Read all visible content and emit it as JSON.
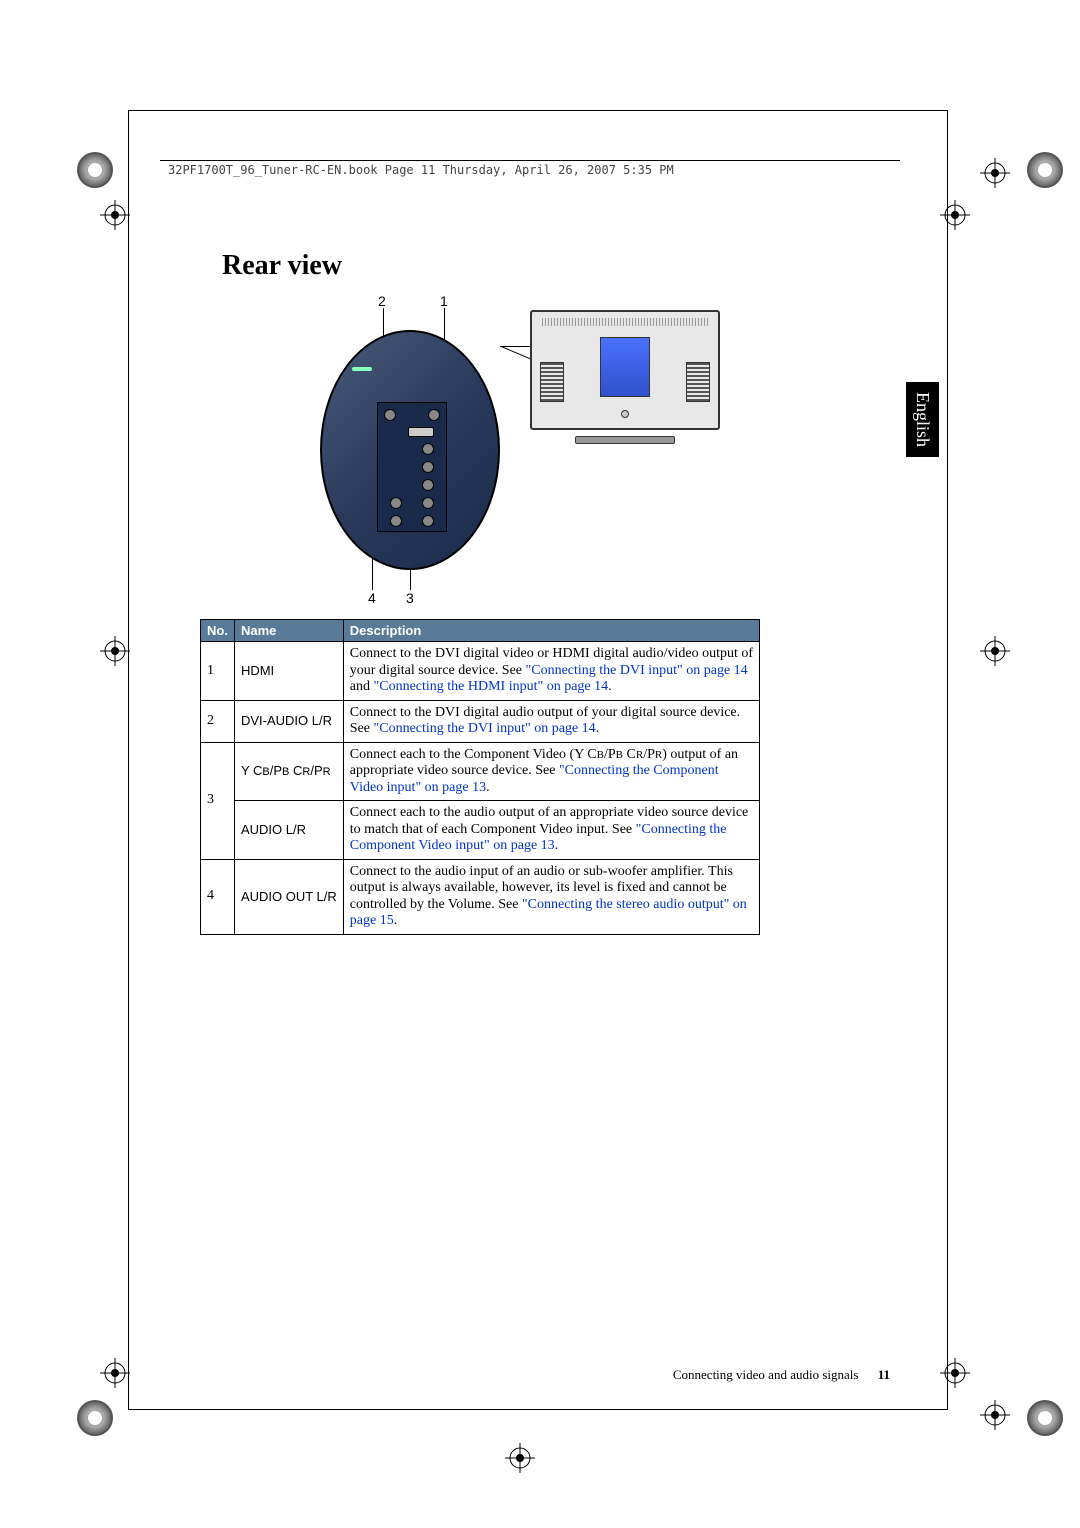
{
  "header_text": "32PF1700T_96_Tuner-RC-EN.book  Page 11  Thursday, April 26, 2007  5:35 PM",
  "title": "Rear view",
  "language_tab": "English",
  "callouts": {
    "c1": "1",
    "c2": "2",
    "c3": "3",
    "c4": "4"
  },
  "table": {
    "headers": {
      "no": "No.",
      "name": "Name",
      "desc": "Description"
    },
    "rows": [
      {
        "no": "1",
        "name": "HDMI",
        "desc_pre": "Connect to the DVI digital video or HDMI digital audio/video output of your digital source device. See ",
        "link1": "\"Connecting the DVI input\" on page 14",
        "mid": " and ",
        "link2": "\"Connecting the HDMI input\" on page 14",
        "post": "."
      },
      {
        "no": "2",
        "name": "DVI-AUDIO L/R",
        "desc_pre": "Connect to the DVI digital audio output of your digital source device. See ",
        "link1": "\"Connecting the DVI input\" on page 14",
        "post": "."
      },
      {
        "no": "3",
        "name_a_pre": "Y C",
        "name_a_sub1": "B",
        "name_a_mid1": "/P",
        "name_a_sub2": "B",
        "name_a_mid2": " C",
        "name_a_sub3": "R",
        "name_a_mid3": "/P",
        "name_a_sub4": "R",
        "desc_a_pre": "Connect each to the Component Video (Y C",
        "desc_a_sub1": "B",
        "desc_a_mid1": "/P",
        "desc_a_sub2": "B",
        "desc_a_mid2": " C",
        "desc_a_sub3": "R",
        "desc_a_mid3": "/P",
        "desc_a_sub4": "R",
        "desc_a_close": ") output of an appropriate video source device. See ",
        "link_a": "\"Connecting the Component Video input\" on page 13",
        "post_a": ".",
        "name_b": "AUDIO L/R",
        "desc_b_pre": "Connect each to the audio output of an appropriate video source device to match that of each Component Video input. See ",
        "link_b": "\"Connecting the Component Video input\" on page 13",
        "post_b": "."
      },
      {
        "no": "4",
        "name": "AUDIO OUT L/R",
        "desc_pre": "Connect to the audio input of an audio or sub-woofer amplifier. This output is always available, however, its level is fixed and cannot be controlled by the Volume. See ",
        "link1": "\"Connecting the stereo audio output\" on page 15",
        "post": "."
      }
    ]
  },
  "footer": {
    "section": "Connecting video and audio signals",
    "page": "11"
  }
}
